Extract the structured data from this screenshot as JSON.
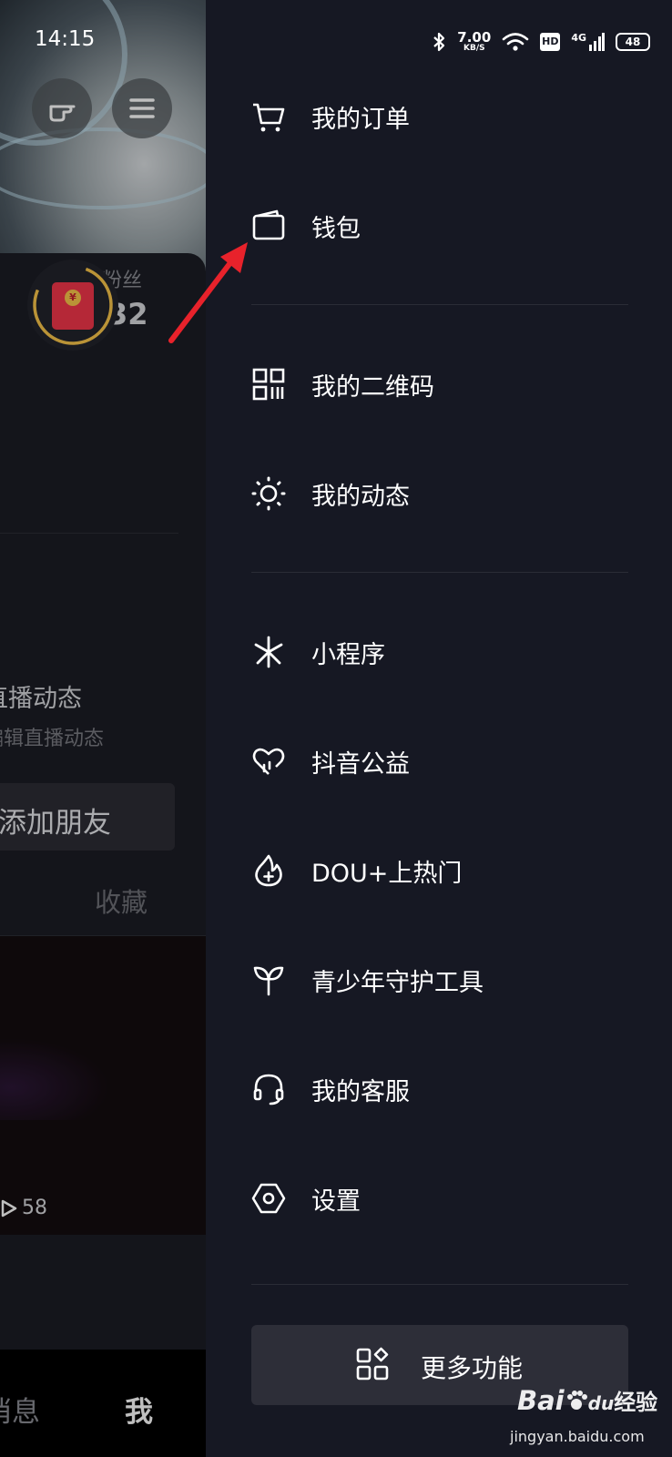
{
  "status_bar": {
    "time": "14:15",
    "net_speed": "7.00",
    "net_speed_unit": "KB/S",
    "hd": "HD",
    "signal": "4G",
    "battery": "48"
  },
  "background_page": {
    "fans_label": "粉丝",
    "fans_value": "32",
    "redpack_symbol": "¥",
    "live_title": "直播动态",
    "live_subtitle": "编辑直播动态",
    "add_friend": "添加朋友",
    "favorites_tab": "收藏",
    "play_count": "58",
    "nav_messages": "消息",
    "nav_me": "我"
  },
  "drawer": {
    "items": [
      {
        "label": "我的订单",
        "icon": "cart-icon"
      },
      {
        "label": "钱包",
        "icon": "wallet-icon"
      },
      {
        "label": "我的二维码",
        "icon": "qr-code-icon"
      },
      {
        "label": "我的动态",
        "icon": "sun-icon"
      },
      {
        "label": "小程序",
        "icon": "mini-program-icon"
      },
      {
        "label": "抖音公益",
        "icon": "charity-heart-icon"
      },
      {
        "label": "DOU+上热门",
        "icon": "flame-plus-icon"
      },
      {
        "label": "青少年守护工具",
        "icon": "sprout-icon"
      },
      {
        "label": "我的客服",
        "icon": "headset-icon"
      },
      {
        "label": "设置",
        "icon": "settings-hexagon-icon"
      }
    ],
    "more_button": "更多功能"
  },
  "watermark": {
    "brand_latin": "Bai",
    "brand_mid": "du",
    "brand_cn": "经验",
    "url": "jingyan.baidu.com"
  },
  "colors": {
    "drawer_bg": "#161823",
    "annotation_arrow": "#e8222b",
    "redpack": "#f2364a",
    "ring": "#f8c54a"
  }
}
